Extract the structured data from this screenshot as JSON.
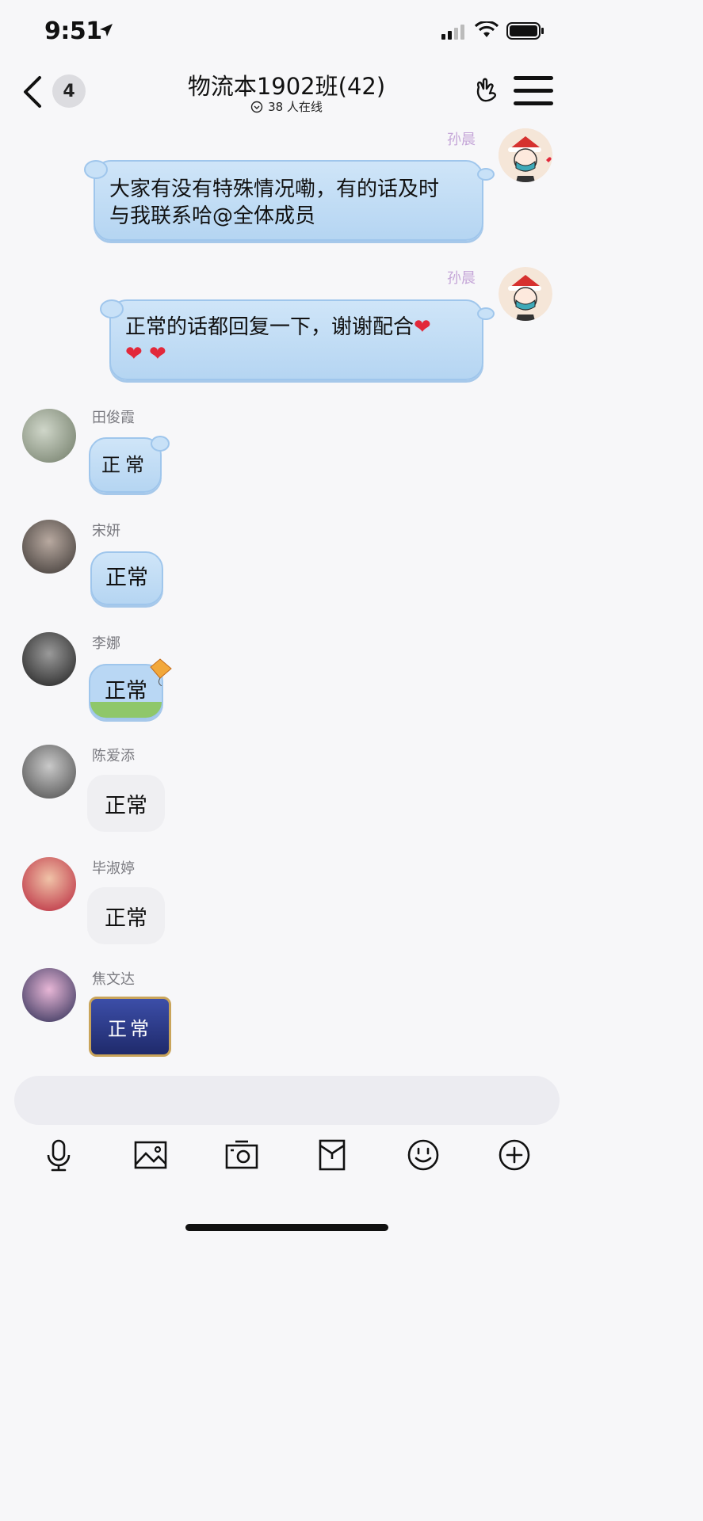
{
  "status_bar": {
    "time": "9:51"
  },
  "nav": {
    "back_badge": "4",
    "title": "物流本1902班(42)",
    "subtitle": "38 人在线"
  },
  "messages": [
    {
      "sender": "孙晨",
      "side": "right",
      "text_line1": "大家有没有特殊情况嘞，有的话及时",
      "text_line2": "与我联系哈@全体成员"
    },
    {
      "sender": "孙晨",
      "side": "right",
      "text_line1": "正常的话都回复一下，谢谢配合",
      "hearts": "❤ ❤"
    },
    {
      "sender": "田俊霞",
      "side": "left",
      "text": "正常"
    },
    {
      "sender": "宋妍",
      "side": "left",
      "text": "正常"
    },
    {
      "sender": "李娜",
      "side": "left",
      "text": "正常"
    },
    {
      "sender": "陈爱添",
      "side": "left",
      "text": "正常"
    },
    {
      "sender": "毕淑婷",
      "side": "left",
      "text": "正常"
    },
    {
      "sender": "焦文达",
      "side": "left",
      "text": "正常"
    }
  ],
  "toolbar": {
    "icons": [
      "microphone-icon",
      "image-icon",
      "camera-icon",
      "red-packet-icon",
      "emoji-icon",
      "plus-icon"
    ]
  },
  "colors": {
    "bubble_blue": "#b5d5f2",
    "bubble_gray": "#efeff2",
    "heart": "#e2283a"
  }
}
